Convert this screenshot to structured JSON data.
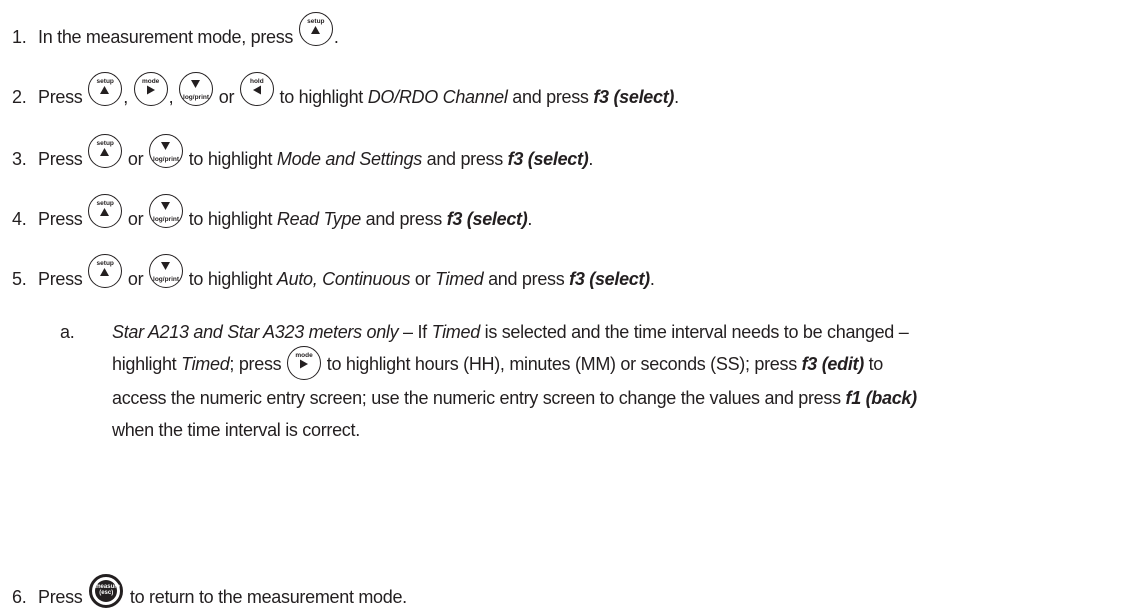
{
  "steps": [
    {
      "num": "1.",
      "text_a": "In the measurement mode, press",
      "text_b": "."
    },
    {
      "num": "2.",
      "text_a": "Press",
      "sep1": ",",
      "sep2": ",",
      "or": "or",
      "text_b": "to highlight",
      "target": "DO/RDO Channel",
      "text_c": "and press",
      "action": "f3 (select)",
      "end": "."
    },
    {
      "num": "3.",
      "text_a": "Press",
      "or": "or",
      "text_b": "to highlight",
      "target": "Mode and Settings",
      "text_c": "and press",
      "action": "f3 (select)",
      "end": "."
    },
    {
      "num": "4.",
      "text_a": "Press",
      "or": "or",
      "text_b": "to highlight",
      "target": "Read Type",
      "text_c": "and press",
      "action": "f3 (select)",
      "end": "."
    },
    {
      "num": "5.",
      "text_a": "Press",
      "or": "or",
      "text_b": "to highlight",
      "target1": "Auto, Continuous",
      "or2": "or",
      "target2": "Timed",
      "text_c": "and press",
      "action": "f3 (select)",
      "end": "."
    },
    {
      "num": "6.",
      "text_a": "Press",
      "text_b": "to return to the measurement mode."
    }
  ],
  "substep": {
    "num": "a.",
    "meters": "Star A213 and Star A323 meters only",
    "t1": " – If ",
    "timed1": "Timed",
    "t2": " is selected and the time interval needs to be changed –",
    "t3": "highlight ",
    "timed2": "Timed",
    "t4": "; press",
    "t5": "to highlight hours (HH), minutes (MM) or seconds (SS); press ",
    "edit": "f3 (edit)",
    "t6": " to",
    "t7": "access the numeric entry screen; use the numeric entry screen to change the values and press ",
    "back": "f1 (back)",
    "t8": "when the time interval is correct."
  },
  "keys": {
    "setup": {
      "label": "setup",
      "icon": "up-arrow-icon"
    },
    "mode": {
      "label": "mode",
      "icon": "right-arrow-icon"
    },
    "log_print": {
      "label": "log/print",
      "icon": "down-arrow-icon"
    },
    "hold": {
      "label": "hold",
      "icon": "left-arrow-icon"
    },
    "measure": {
      "label1": "measure",
      "label2": "(esc)"
    }
  }
}
